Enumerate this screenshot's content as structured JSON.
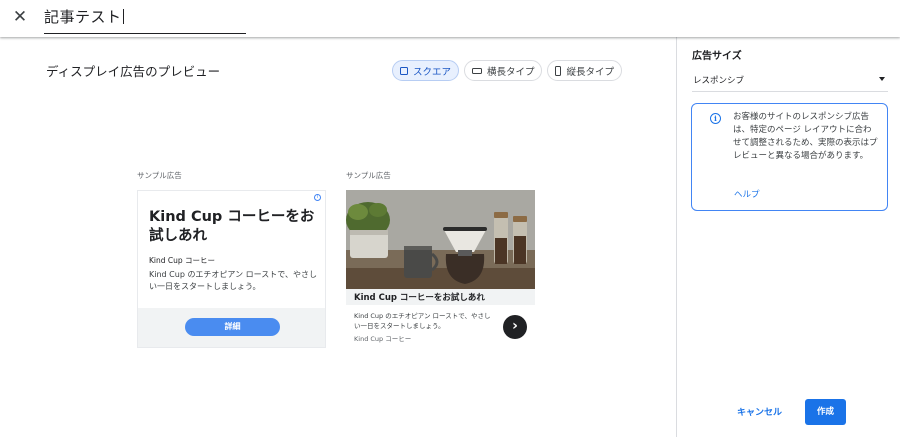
{
  "header": {
    "close_icon": "close-icon",
    "title": "記事テスト"
  },
  "main": {
    "preview_title": "ディスプレイ広告のプレビュー",
    "tabs": [
      {
        "label": "スクエア",
        "icon": "square-icon",
        "selected": true
      },
      {
        "label": "横長タイプ",
        "icon": "landscape-icon",
        "selected": false
      },
      {
        "label": "縦長タイプ",
        "icon": "portrait-icon",
        "selected": false
      }
    ],
    "ad1": {
      "label": "サンプル広告",
      "headline": "Kind Cup コーヒーをお試しあれ",
      "brand": "Kind Cup コーヒー",
      "description": "Kind Cup のエチオピアン ローストで、やさしい一日をスタートしましょう。",
      "button_label": "詳細"
    },
    "ad2": {
      "label": "サンプル広告",
      "headline": "Kind Cup コーヒーをお試しあれ",
      "description": "Kind Cup のエチオピアン ローストで、やさしい一日をスタートしましょう。",
      "brand": "Kind Cup コーヒー"
    }
  },
  "panel": {
    "heading": "広告サイズ",
    "select_value": "レスポンシブ",
    "info_text": "お客様のサイトのレスポンシブ広告は、特定のページ レイアウトに合わせて調整されるため、実際の表示はプレビューと異なる場合があります。",
    "help_link": "ヘルプ",
    "cancel_label": "キャンセル",
    "create_label": "作成"
  },
  "colors": {
    "accent": "#1a73e8",
    "chip_selected_bg": "#e8f0fe",
    "ad_button": "#4a8cf0"
  }
}
